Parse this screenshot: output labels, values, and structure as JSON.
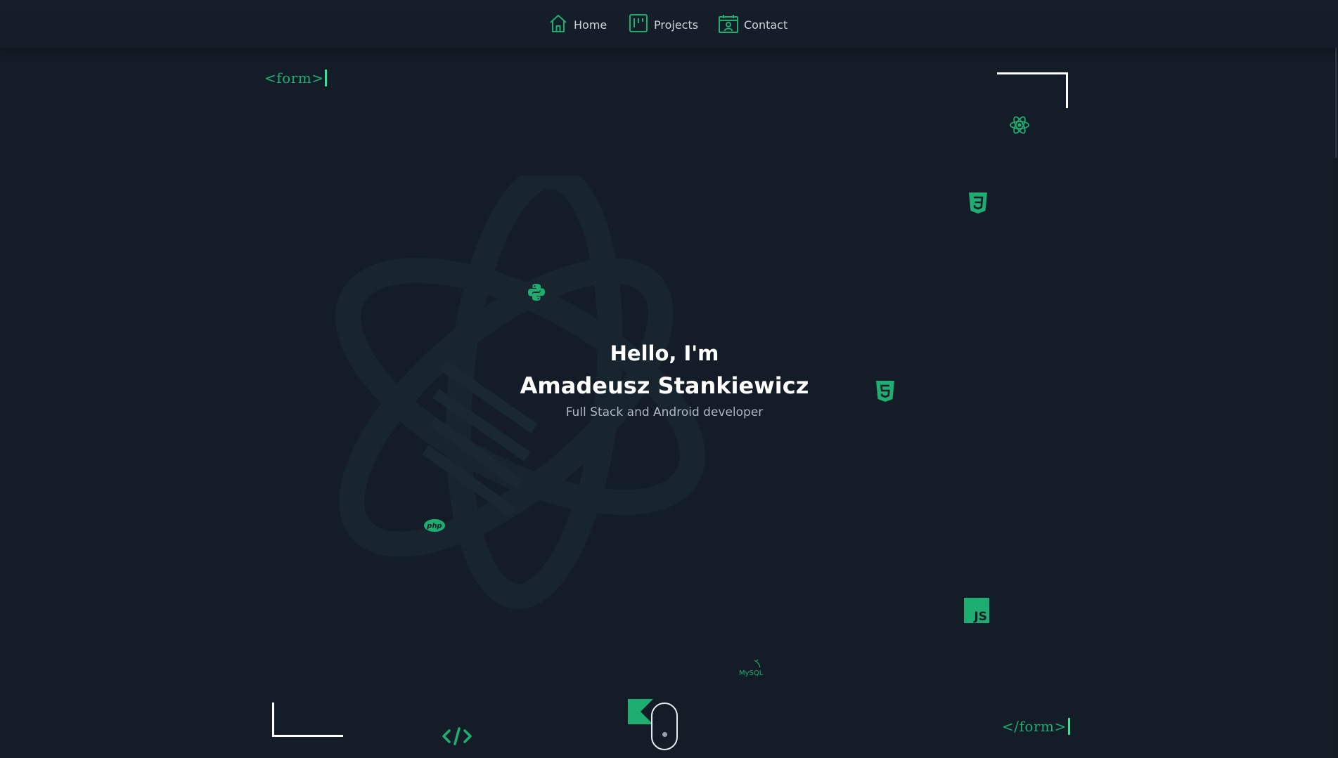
{
  "nav": {
    "items": [
      {
        "label": "Home",
        "icon": "home-icon"
      },
      {
        "label": "Projects",
        "icon": "kanban-icon"
      },
      {
        "label": "Contact",
        "icon": "contact-card-icon"
      }
    ]
  },
  "code_tags": {
    "open": "<form>",
    "close": "</form>"
  },
  "hero": {
    "greeting": "Hello, I'm",
    "name": "Amadeusz Stankiewicz",
    "role": "Full Stack and Android developer"
  },
  "floating_icons": {
    "names": [
      "react-icon",
      "css3-icon",
      "python-icon",
      "html5-icon",
      "php-icon",
      "javascript-icon",
      "mysql-icon",
      "code-icon",
      "kotlin-icon"
    ],
    "php_label": "php",
    "js_label": "JS",
    "mysql_label": "MySQL"
  },
  "colors": {
    "background": "#141c27",
    "accent": "#1fae72",
    "caret": "#2ee89a",
    "text": "#ffffff",
    "muted": "#aeb6c1"
  }
}
